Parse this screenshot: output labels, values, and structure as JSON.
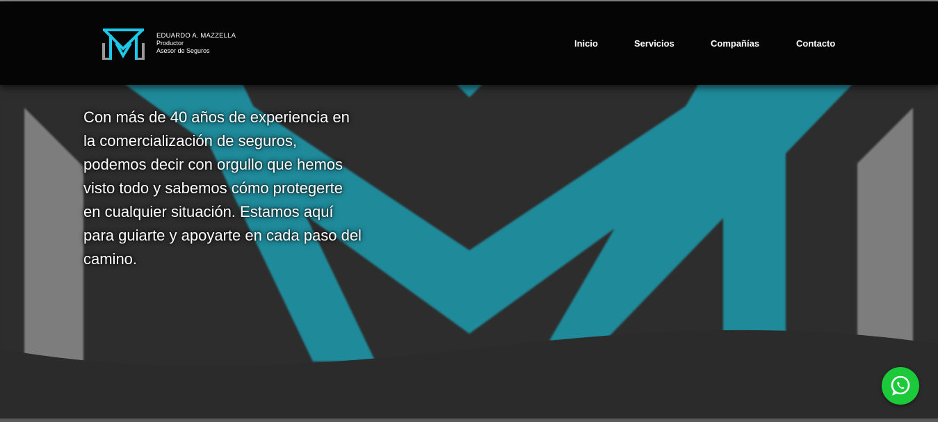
{
  "brand": {
    "name": "EDUARDO A. MAZZELLA",
    "line2": "Productor",
    "line3": "Asesor de Seguros",
    "logo_icon": "m-monogram-logo-icon",
    "logo_color": "#1ec8e8"
  },
  "nav": {
    "items": [
      {
        "label": "Inicio"
      },
      {
        "label": "Servicios"
      },
      {
        "label": "Compañías"
      },
      {
        "label": "Contacto"
      }
    ]
  },
  "hero": {
    "text": "Con más de 40 años de experiencia en la comercialización de seguros, podemos decir con orgullo que hemos visto todo y sabemos cómo protegerte en cualquier situación. Estamos aquí para guiarte y apoyarte en cada paso del camino.",
    "accent_color": "#1f8a9a",
    "bg_color": "#2d2d2d"
  },
  "floating": {
    "whatsapp_icon": "whatsapp-icon",
    "whatsapp_color": "#1cc93a"
  }
}
